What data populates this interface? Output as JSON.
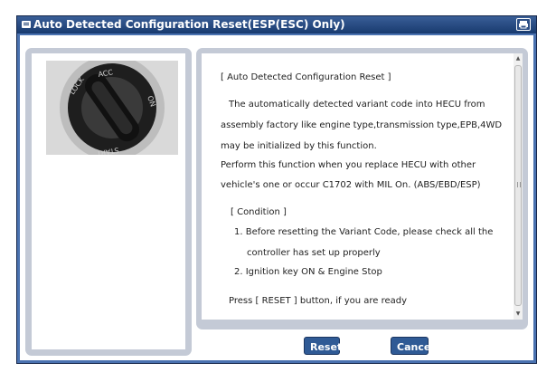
{
  "window": {
    "title": "Auto Detected Configuration Reset(ESP(ESC) Only)",
    "title_icon": "window-menu-icon",
    "title_button_icon": "print-icon"
  },
  "image": {
    "description_icon": "ignition-key-icon",
    "key_labels": [
      "LOCK",
      "ACC",
      "ON",
      "START"
    ]
  },
  "message": {
    "lines": [
      "[ Auto Detected Configuration Reset ]",
      "The automatically detected variant code into HECU from",
      "assembly factory like engine type,transmission type,EPB,4WD",
      "may be initialized by this function.",
      "Perform this function when you replace HECU with other",
      "vehicle's one or occur C1702 with MIL On. (ABS/EBD/ESP)",
      "[ Condition ]",
      "1. Before resetting the Variant Code, please check all the",
      "controller has set up properly",
      "2. Ignition key ON & Engine Stop",
      "Press [ RESET ] button, if you are ready"
    ]
  },
  "buttons": {
    "reset_label": "Reset",
    "cancel_label": "Cancel"
  },
  "colors": {
    "window_frame": "#4a72b0",
    "title_bar": "#1d3f74",
    "panel_border": "#c4cad6",
    "button": "#2f5a95"
  }
}
